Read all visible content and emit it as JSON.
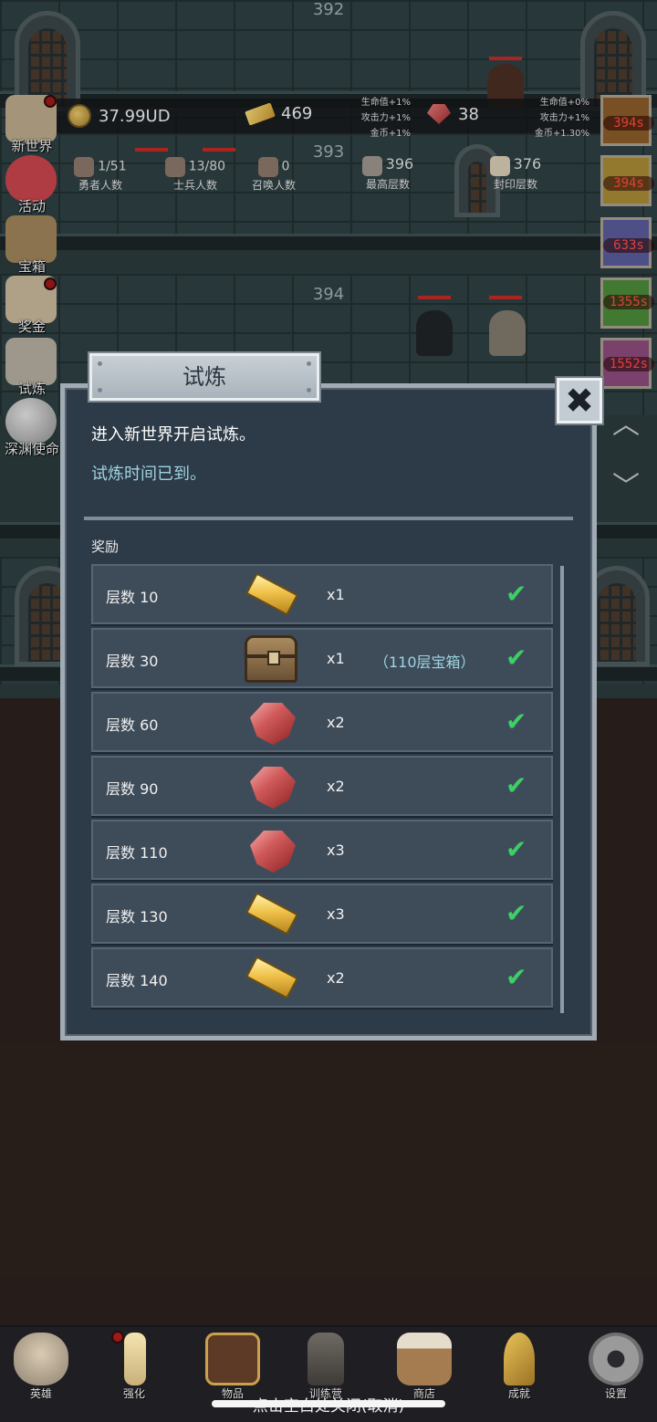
{
  "floors": {
    "top": "392",
    "middle": "393",
    "lower": "394"
  },
  "stats": {
    "currency": "37.99UD",
    "gold_bars": "469",
    "gems": "38",
    "bonus_left": [
      "生命值+1%",
      "攻击力+1%",
      "金币+1%"
    ],
    "bonus_right": [
      "生命值+0%",
      "攻击力+1%",
      "金币+1.30%"
    ],
    "heroes": {
      "value": "1/51",
      "label": "勇者人数"
    },
    "soldiers": {
      "value": "13/80",
      "label": "士兵人数"
    },
    "summons": {
      "value": "0",
      "label": "召唤人数"
    },
    "max_floor": {
      "value": "396",
      "label": "最高层数"
    },
    "seal_floor": {
      "value": "376",
      "label": "封印层数"
    }
  },
  "sidebar": {
    "items": [
      {
        "label": "新世界",
        "icon": "map-icon",
        "badge": true
      },
      {
        "label": "活动",
        "icon": "heart-icon",
        "badge": false
      },
      {
        "label": "宝箱",
        "icon": "chest-icon",
        "badge": false
      },
      {
        "label": "奖金",
        "icon": "letter-icon",
        "badge": true
      },
      {
        "label": "试炼",
        "icon": "feather-icon",
        "badge": false
      },
      {
        "label": "深渊使命",
        "icon": "orb-icon",
        "badge": false
      }
    ]
  },
  "timers": [
    "394s",
    "394s",
    "633s",
    "1355s",
    "1552s"
  ],
  "dialog": {
    "title": "试炼",
    "close_glyph": "✖",
    "intro": "进入新世界开启试炼。",
    "status": "试炼时间已到。",
    "rewards_title": "奖励",
    "rewards": [
      {
        "label": "层数 10",
        "icon": "gold-bar-icon",
        "qty": "x1",
        "note": "",
        "claimed": true
      },
      {
        "label": "层数 30",
        "icon": "chest-icon",
        "qty": "x1",
        "note": "（110层宝箱）",
        "claimed": true
      },
      {
        "label": "层数 60",
        "icon": "ruby-icon",
        "qty": "x2",
        "note": "",
        "claimed": true
      },
      {
        "label": "层数 90",
        "icon": "ruby-icon",
        "qty": "x2",
        "note": "",
        "claimed": true
      },
      {
        "label": "层数 110",
        "icon": "ruby-icon",
        "qty": "x3",
        "note": "",
        "claimed": true
      },
      {
        "label": "层数 130",
        "icon": "gold-bar-icon",
        "qty": "x3",
        "note": "",
        "claimed": true
      },
      {
        "label": "层数 140",
        "icon": "gold-bar-icon",
        "qty": "x2",
        "note": "",
        "claimed": true
      }
    ]
  },
  "bottom_nav": [
    {
      "label": "英雄",
      "icon": "skull-icon",
      "badge": false
    },
    {
      "label": "强化",
      "icon": "candle-icon",
      "badge": true
    },
    {
      "label": "物品",
      "icon": "book-icon",
      "badge": false
    },
    {
      "label": "训练营",
      "icon": "lantern-icon",
      "badge": false
    },
    {
      "label": "商店",
      "icon": "mug-icon",
      "badge": false
    },
    {
      "label": "成就",
      "icon": "key-icon",
      "badge": false
    },
    {
      "label": "设置",
      "icon": "gear-icon",
      "badge": false
    }
  ],
  "tap_hint": "点击空白处关闭(取消)",
  "colors": {
    "check": "#3ccf66",
    "timer_text": "#ff4a3d",
    "accent_text": "#9fd3e0"
  }
}
